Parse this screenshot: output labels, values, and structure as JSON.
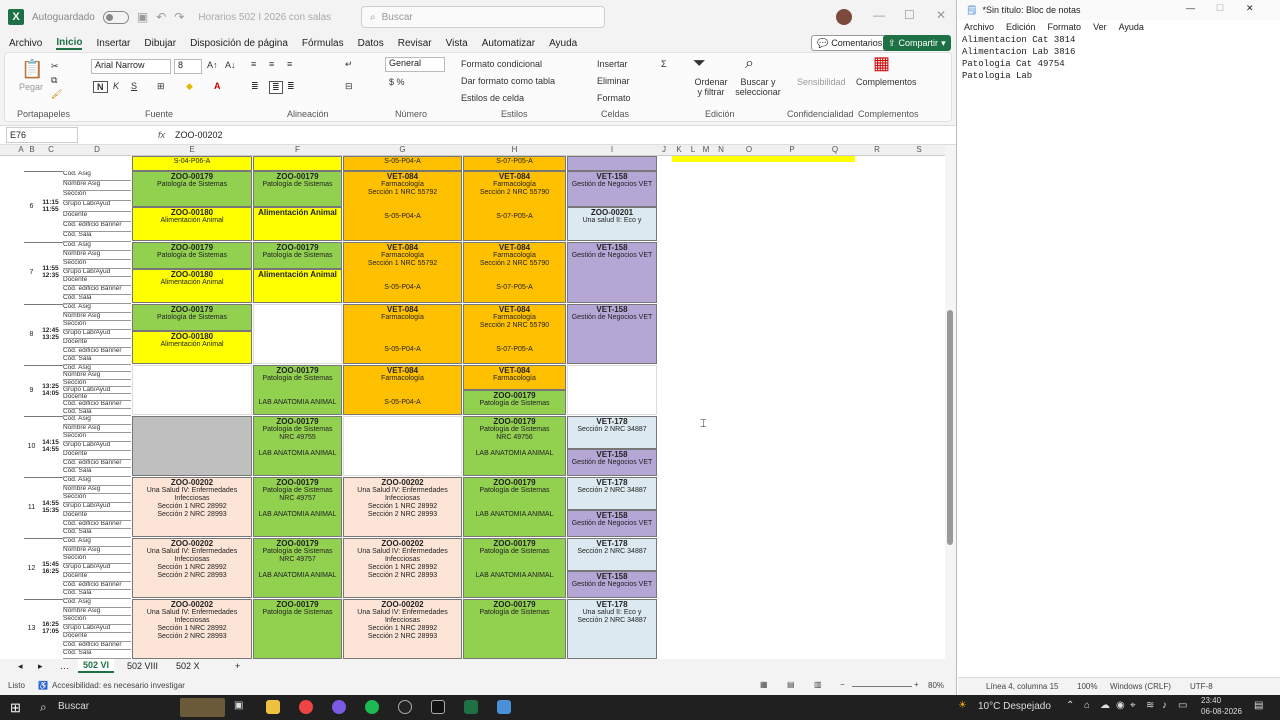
{
  "excel": {
    "autosave_label": "Autoguardado",
    "doc_title": "Horarios 502 I 2026 con salas",
    "search_placeholder": "Buscar",
    "menu": [
      "Archivo",
      "Inicio",
      "Insertar",
      "Dibujar",
      "Disposición de página",
      "Fórmulas",
      "Datos",
      "Revisar",
      "Vista",
      "Automatizar",
      "Ayuda"
    ],
    "comments_label": "Comentarios",
    "share_label": "Compartir",
    "ribbon": {
      "paste": "Pegar",
      "font_name": "Arial Narrow",
      "font_size": "8",
      "number_format": "General",
      "cond_format": "Formato condicional",
      "table_format": "Dar formato como tabla",
      "cell_styles": "Estilos de celda",
      "insert": "Insertar",
      "delete": "Eliminar",
      "format": "Formato",
      "sort_filter": "Ordenar y filtrar",
      "find_select": "Buscar y seleccionar",
      "sensitivity": "Sensibilidad",
      "addins": "Complementos",
      "groups": [
        "Portapapeles",
        "Fuente",
        "Alineación",
        "Número",
        "Estilos",
        "Celdas",
        "Edición",
        "Confidencialidad",
        "Complementos"
      ]
    },
    "name_box": "E76",
    "formula": "ZOO-00202",
    "columns": [
      "A",
      "B",
      "C",
      "D",
      "E",
      "F",
      "G",
      "H",
      "I",
      "J",
      "K",
      "L",
      "M",
      "N",
      "O",
      "P",
      "Q",
      "R",
      "S"
    ],
    "row_labels": [
      "Cod. Asig",
      "Nombre Asig",
      "Sección",
      "Grupo Lab/Ayud",
      "Docente",
      "Cód. edificio Banner",
      "Cód. Sala"
    ],
    "blocks": [
      {
        "num": "6",
        "time": "11:15 11:55"
      },
      {
        "num": "7",
        "time": "11:55 12:35"
      },
      {
        "num": "8",
        "time": "12:45 13:25"
      },
      {
        "num": "9",
        "time": "13:25 14:05"
      },
      {
        "num": "10",
        "time": "14:15 14:55"
      },
      {
        "num": "11",
        "time": "14:55 15:35"
      },
      {
        "num": "12",
        "time": "15:45 16:25"
      },
      {
        "num": "13",
        "time": "16:25 17:05"
      }
    ],
    "cells": {
      "zoo179": "ZOO-00179",
      "pato": "Patología de Sistemas",
      "zoo180": "ZOO-00180",
      "alim": "Alimentación Animal",
      "vet084": "VET-084",
      "farma": "Farmacología",
      "vet158": "VET-158",
      "gestion": "Gestión de Negocios VET",
      "zoo201": "ZOO-00201",
      "unasalud2": "Una salud II: Eco y",
      "zoo202": "ZOO-00202",
      "unasalud4": "Una Salud IV: Enfermedades Infecciosas",
      "vet178": "VET-178",
      "sec1_55792": "Sección 1 NRC 55792",
      "sec2_55790": "Sección 2 NRC 55790",
      "sala_g": "S-05-P04-A",
      "sala_h": "S-07-P05-A",
      "sala_e": "S-04-P06-A",
      "lab_anat": "LAB ANATOMIA ANIMAL",
      "nrc_49757": "NRC 49757",
      "nrc_49755": "NRC 49755",
      "nrc_49756": "NRC 49756",
      "nrc_34887": "Sección 2 NRC 34887",
      "sec_28992": "Sección 1 NRC 28992",
      "sec_28993": "Sección 2 NRC 28993"
    },
    "sheets": [
      "502 VI",
      "502 VIII",
      "502 X"
    ],
    "status_ready": "Listo",
    "accessibility": "Accesibilidad: es necesario investigar",
    "zoom": "80%"
  },
  "notepad": {
    "title": "*Sin título: Bloc de notas",
    "menu": [
      "Archivo",
      "Edición",
      "Formato",
      "Ver",
      "Ayuda"
    ],
    "lines": "Alimentacion Cat 3814\nAlimentacion Lab 3816\nPatologia Cat 49754\nPatologia Lab ",
    "status": {
      "position": "Línea 4, columna 15",
      "zoom": "100%",
      "eol": "Windows (CRLF)",
      "encoding": "UTF-8"
    }
  },
  "taskbar": {
    "search": "Buscar",
    "weather": "10°C Despejado",
    "time": "23:40",
    "date": "06-08-2026"
  }
}
